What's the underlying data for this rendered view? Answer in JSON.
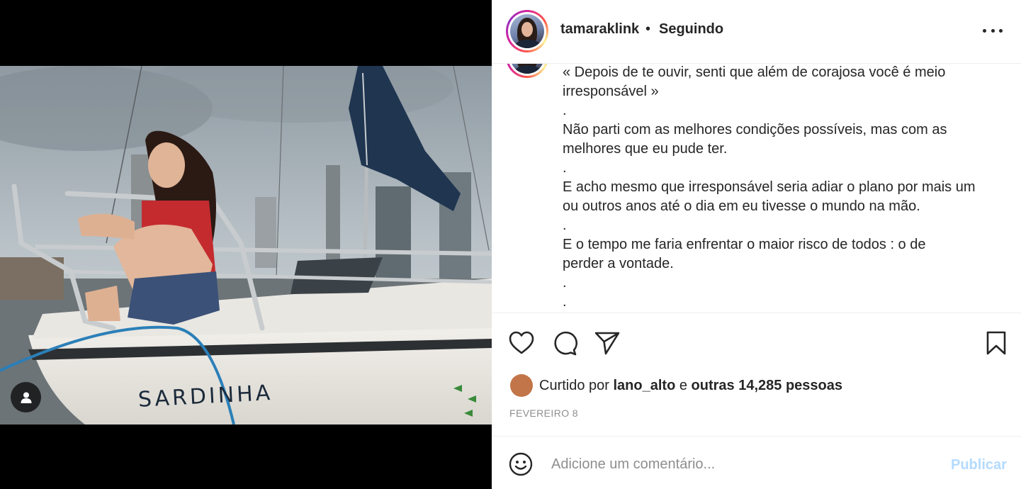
{
  "post": {
    "username": "tamaraklink",
    "separator": "•",
    "follow_status": "Seguindo",
    "caption_lines": [
      "« Depois de te ouvir, senti que além de corajosa você é meio",
      "irresponsável »",
      ".",
      "Não parti com as melhores condições possíveis, mas com as",
      "melhores que eu pude ter.",
      ".",
      "E acho mesmo que irresponsável seria adiar o plano por mais um",
      "ou outros anos até o dia em eu tivesse o mundo na mão.",
      ".",
      "E o tempo me faria enfrentar o maior risco de todos : o de",
      "perder a vontade.",
      ".",
      "."
    ],
    "boat_name": "SARDINHA"
  },
  "likes": {
    "prefix": "Curtido por",
    "first_user": "lano_alto",
    "conjunction": "e",
    "others": "outras 14,285 pessoas"
  },
  "date": "FEVEREIRO 8",
  "comment": {
    "placeholder": "Adicione um comentário...",
    "publish_label": "Publicar"
  },
  "colors": {
    "text": "#262626",
    "muted": "#8e8e8e",
    "publish_disabled": "#b3dbff",
    "divider": "#efefef"
  },
  "icons": [
    "user-tag-icon",
    "more-options-icon",
    "heart-icon",
    "comment-icon",
    "share-icon",
    "bookmark-icon",
    "emoji-icon"
  ]
}
